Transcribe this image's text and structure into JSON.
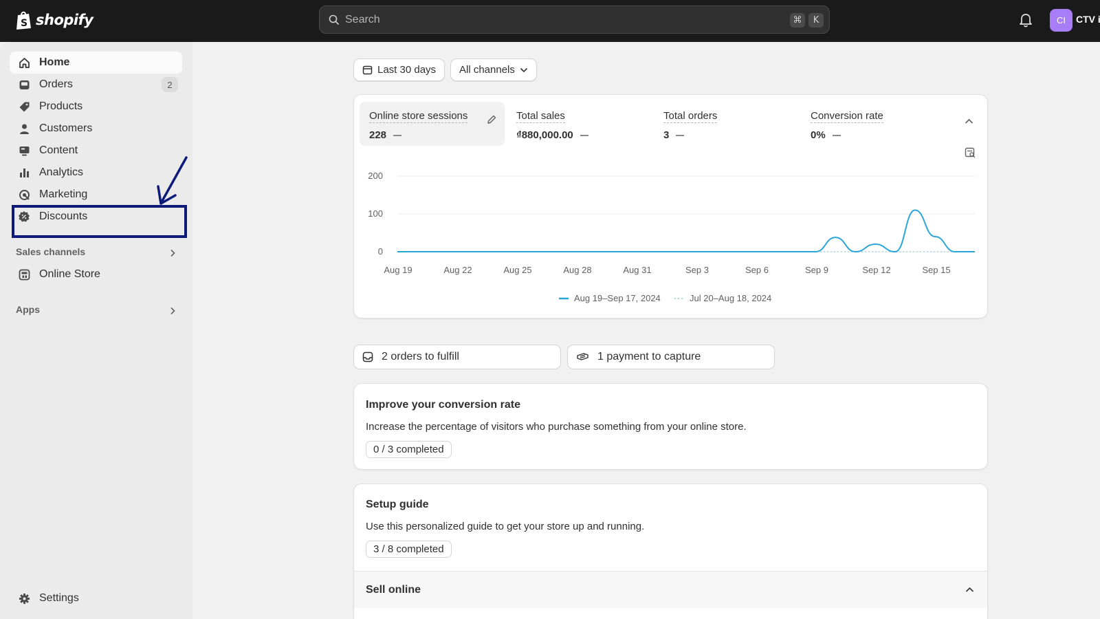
{
  "topbar": {
    "logo_text": "shopify",
    "search_placeholder": "Search",
    "shortcut_keys": [
      "⌘",
      "K"
    ],
    "avatar_initials": "CI",
    "store_name": "CTV i"
  },
  "sidebar": {
    "items": [
      {
        "label": "Home",
        "icon": "home-icon",
        "active": true
      },
      {
        "label": "Orders",
        "icon": "orders-icon",
        "badge": "2"
      },
      {
        "label": "Products",
        "icon": "tag-icon"
      },
      {
        "label": "Customers",
        "icon": "person-icon"
      },
      {
        "label": "Content",
        "icon": "content-icon"
      },
      {
        "label": "Analytics",
        "icon": "bar-chart-icon"
      },
      {
        "label": "Marketing",
        "icon": "target-icon"
      },
      {
        "label": "Discounts",
        "icon": "discount-icon"
      }
    ],
    "sales_channels_label": "Sales channels",
    "online_store_label": "Online Store",
    "apps_label": "Apps",
    "settings_label": "Settings"
  },
  "filters": {
    "date_range": "Last 30 days",
    "channels": "All channels"
  },
  "metrics": [
    {
      "label": "Online store sessions",
      "value": "228"
    },
    {
      "label": "Total sales",
      "value": "₫880,000.00"
    },
    {
      "label": "Total orders",
      "value": "3"
    },
    {
      "label": "Conversion rate",
      "value": "0%"
    }
  ],
  "chart_data": {
    "type": "line",
    "ylim": [
      0,
      200
    ],
    "yticks": [
      "200",
      "100",
      "0"
    ],
    "x_labels": [
      "Aug 19",
      "Aug 22",
      "Aug 25",
      "Aug 28",
      "Aug 31",
      "Sep 3",
      "Sep 6",
      "Sep 9",
      "Sep 12",
      "Sep 15"
    ],
    "series": [
      {
        "name": "Aug 19–Sep 17, 2024",
        "color": "#2aa5d6",
        "style": "solid",
        "values": [
          0,
          0,
          0,
          0,
          0,
          0,
          0,
          0,
          0,
          0,
          0,
          0,
          0,
          0,
          0,
          0,
          0,
          0,
          0,
          0,
          0,
          0,
          38,
          0,
          20,
          0,
          110,
          40,
          0,
          0
        ]
      },
      {
        "name": "Jul 20–Aug 18, 2024",
        "color": "#a8d4e8",
        "style": "dotted",
        "values": [
          0,
          0,
          0,
          0,
          0,
          0,
          0,
          0,
          0,
          0,
          0,
          0,
          0,
          0,
          0,
          0,
          0,
          0,
          0,
          0,
          0,
          0,
          0,
          0,
          0,
          0,
          0,
          0,
          0,
          0
        ]
      }
    ]
  },
  "tasks": {
    "orders": "2 orders to fulfill",
    "payments": "1 payment to capture"
  },
  "conversion_card": {
    "title": "Improve your conversion rate",
    "description": "Increase the percentage of visitors who purchase something from your online store.",
    "progress": "0 / 3 completed"
  },
  "setup_card": {
    "title": "Setup guide",
    "description": "Use this personalized guide to get your store up and running.",
    "progress": "3 / 8 completed",
    "section": "Sell online"
  }
}
